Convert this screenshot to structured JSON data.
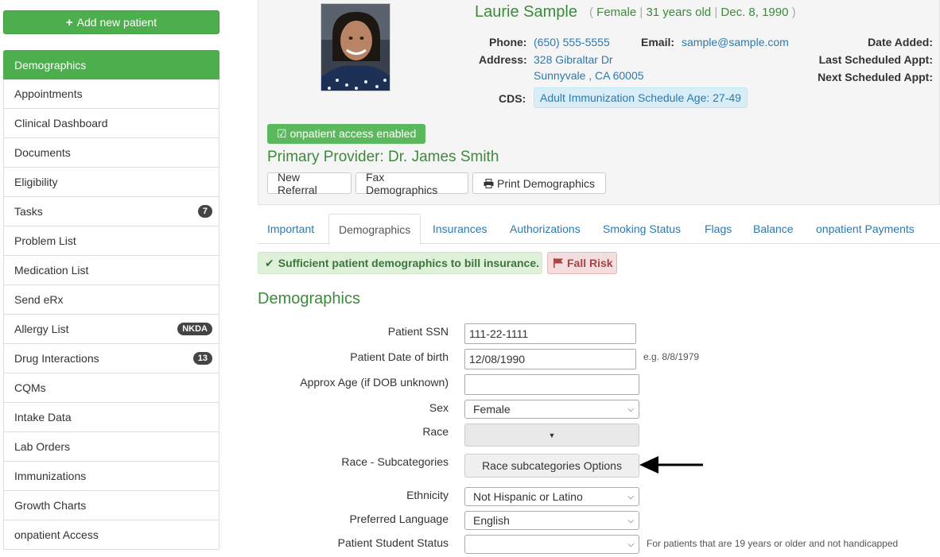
{
  "sidebar": {
    "add_button": "Add new patient",
    "items": [
      {
        "label": "Demographics",
        "badge": ""
      },
      {
        "label": "Appointments",
        "badge": ""
      },
      {
        "label": "Clinical Dashboard",
        "badge": ""
      },
      {
        "label": "Documents",
        "badge": ""
      },
      {
        "label": "Eligibility",
        "badge": ""
      },
      {
        "label": "Tasks",
        "badge": "7"
      },
      {
        "label": "Problem List",
        "badge": ""
      },
      {
        "label": "Medication List",
        "badge": ""
      },
      {
        "label": "Send eRx",
        "badge": ""
      },
      {
        "label": "Allergy List",
        "badge": "NKDA"
      },
      {
        "label": "Drug Interactions",
        "badge": "13"
      },
      {
        "label": "CQMs",
        "badge": ""
      },
      {
        "label": "Intake Data",
        "badge": ""
      },
      {
        "label": "Lab Orders",
        "badge": ""
      },
      {
        "label": "Immunizations",
        "badge": ""
      },
      {
        "label": "Growth Charts",
        "badge": ""
      },
      {
        "label": "onpatient Access",
        "badge": ""
      }
    ]
  },
  "patient": {
    "name": "Laurie Sample",
    "sex": "Female",
    "age": "31 years old",
    "dob": "Dec. 8, 1990",
    "phone_label": "Phone:",
    "phone": "(650) 555-5555",
    "email_label": "Email:",
    "email": "sample@sample.com",
    "address_label": "Address:",
    "address_line1": "328 Gibraltar Dr",
    "address_line2": "Sunnyvale , CA 60005",
    "cds_label": "CDS:",
    "cds_value": "Adult Immunization Schedule Age: 27-49",
    "date_added_label": "Date Added:",
    "last_appt_label": "Last Scheduled Appt:",
    "next_appt_label": "Next Scheduled Appt:",
    "access_badge": "onpatient access enabled",
    "primary_provider": "Primary Provider: Dr. James Smith"
  },
  "actions": {
    "new_referral": "New Referral",
    "fax_demographics": "Fax Demographics",
    "print_demographics": "Print Demographics"
  },
  "tabs": [
    "Important",
    "Demographics",
    "Insurances",
    "Authorizations",
    "Smoking Status",
    "Flags",
    "Balance",
    "onpatient Payments"
  ],
  "alerts": {
    "sufficient": "Sufficient patient demographics to bill insurance.",
    "fall_risk": "Fall Risk"
  },
  "section_title": "Demographics",
  "form": {
    "ssn_label": "Patient SSN",
    "ssn_value": "111-22-1111",
    "dob_label": "Patient Date of birth",
    "dob_value": "12/08/1990",
    "dob_hint": "e.g. 8/8/1979",
    "approx_age_label": "Approx Age (if DOB unknown)",
    "approx_age_value": "",
    "sex_label": "Sex",
    "sex_value": "Female",
    "race_label": "Race",
    "race_sub_label": "Race - Subcategories",
    "race_sub_button": "Race subcategories Options",
    "ethnicity_label": "Ethnicity",
    "ethnicity_value": "Not Hispanic or Latino",
    "language_label": "Preferred Language",
    "language_value": "English",
    "student_label": "Patient Student Status",
    "student_value": "",
    "student_hint": "For patients that are 19 years or older and not handicapped"
  },
  "colors": {
    "primary_green": "#4cae4c",
    "link_blue": "#2a7ab0",
    "heading_green": "#3c8a3c"
  }
}
